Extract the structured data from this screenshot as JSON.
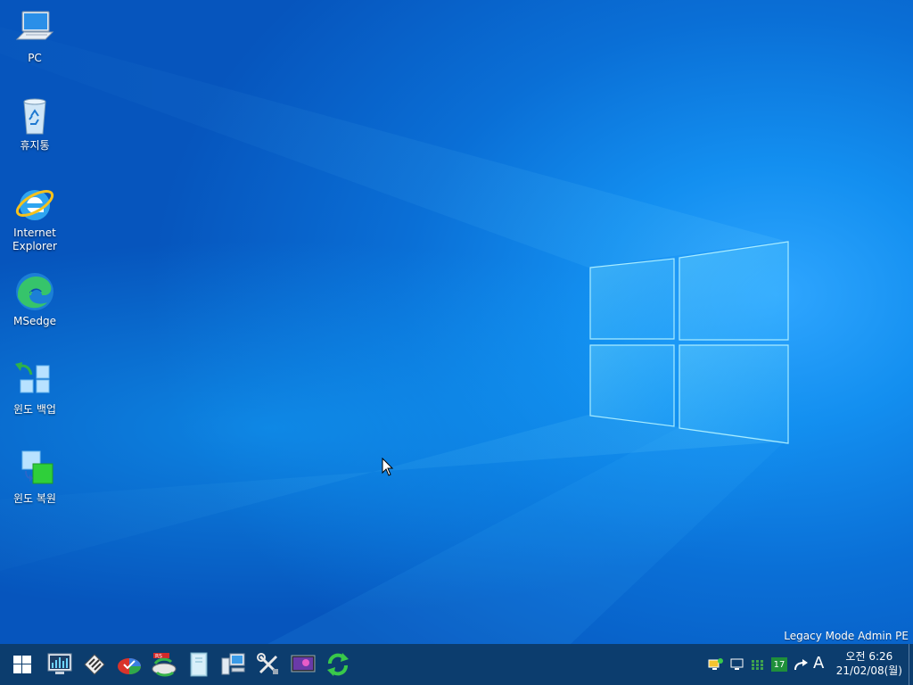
{
  "desktop": {
    "icons": [
      {
        "label": "PC",
        "icon": "pc-icon"
      },
      {
        "label": "휴지통",
        "icon": "recycle-bin-icon"
      },
      {
        "label": "Internet Explorer",
        "icon": "internet-explorer-icon"
      },
      {
        "label": "MSedge",
        "icon": "msedge-icon"
      },
      {
        "label": "윈도 백업",
        "icon": "windows-backup-icon"
      },
      {
        "label": "윈도 복원",
        "icon": "windows-restore-icon"
      }
    ],
    "edition_text": "Legacy Mode Admin PE",
    "accent_color": "#0a7fe0"
  },
  "taskbar": {
    "background": "#0c3d6e",
    "pinned": [
      "start-icon",
      "system-monitor-icon",
      "disk-tool-icon",
      "partition-tool-icon",
      "recovery-tool-icon",
      "file-manager-icon",
      "network-computer-icon",
      "tools-icon",
      "display-icon",
      "refresh-sync-icon"
    ],
    "tray": {
      "calendar_day": "17",
      "ime_label": "A",
      "time": "오전 6:26",
      "date": "21/02/08(월)"
    }
  }
}
